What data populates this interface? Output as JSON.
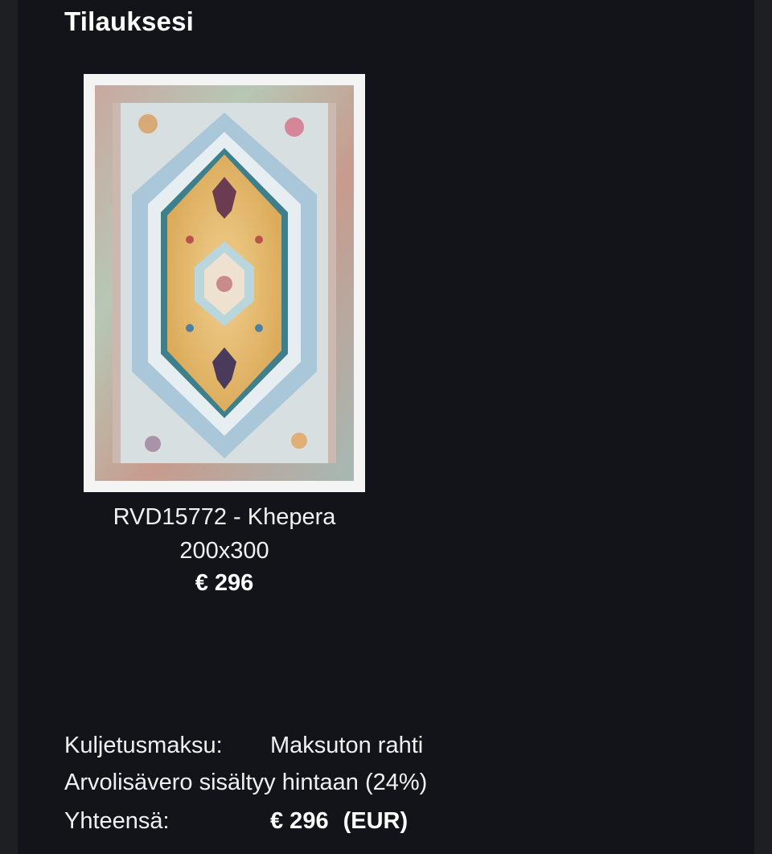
{
  "order": {
    "title": "Tilauksesi",
    "product": {
      "image_alt": "Khepera rug",
      "name": "RVD15772 - Khepera",
      "size": "200x300",
      "price": "€ 296"
    },
    "summary": {
      "shipping_label": "Kuljetusmaksu:",
      "shipping_value": "Maksuton rahti",
      "vat_text": "Arvolisävero sisältyy hintaan (24%)",
      "total_label": "Yhteensä:",
      "total_value": "€ 296",
      "total_currency": "(EUR)"
    }
  },
  "colors": {
    "page_bg": "#12141a",
    "outer_bg": "#1e1f22",
    "text": "#f0f0f0",
    "rug_gold": "#e2b15e",
    "rug_blue": "#a9c7d8",
    "rug_teal": "#3e7f8c",
    "rug_rose": "#c98a8a"
  }
}
